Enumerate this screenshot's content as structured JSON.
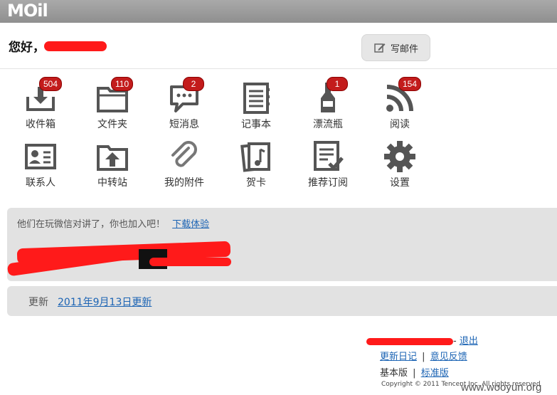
{
  "topbar": {
    "logo_text": "MOil"
  },
  "header": {
    "greeting": "您好，",
    "compose_label": "写邮件"
  },
  "apps": [
    {
      "key": "inbox",
      "label": "收件箱",
      "badge": "504",
      "icon": "inbox-icon"
    },
    {
      "key": "folders",
      "label": "文件夹",
      "badge": "110",
      "icon": "folder-icon"
    },
    {
      "key": "sms",
      "label": "短消息",
      "badge": "2",
      "icon": "message-icon"
    },
    {
      "key": "notes",
      "label": "记事本",
      "badge": "",
      "icon": "notebook-icon"
    },
    {
      "key": "bottle",
      "label": "漂流瓶",
      "badge": "1",
      "icon": "bottle-icon"
    },
    {
      "key": "reader",
      "label": "阅读",
      "badge": "154",
      "icon": "rss-icon"
    },
    {
      "key": "contacts",
      "label": "联系人",
      "badge": "",
      "icon": "contact-card-icon"
    },
    {
      "key": "transfer",
      "label": "中转站",
      "badge": "",
      "icon": "upload-folder-icon"
    },
    {
      "key": "attachments",
      "label": "我的附件",
      "badge": "",
      "icon": "paperclip-icon"
    },
    {
      "key": "cards",
      "label": "贺卡",
      "badge": "",
      "icon": "greeting-card-icon"
    },
    {
      "key": "subscriptions",
      "label": "推荐订阅",
      "badge": "",
      "icon": "subscription-icon"
    },
    {
      "key": "settings",
      "label": "设置",
      "badge": "",
      "icon": "gear-icon"
    }
  ],
  "promo": {
    "text": "他们在玩微信对讲了，你也加入吧！",
    "link": "下载体验"
  },
  "update": {
    "label": "更新",
    "link": "2011年9月13日更新"
  },
  "footer": {
    "logout": "退出",
    "changelog": "更新日记",
    "feedback": "意见反馈",
    "basic": "基本版",
    "standard": "标准版",
    "separator": "|",
    "copyright": "Copyright © 2011 Tencent Inc. All rights reserved",
    "watermark": "www.wooyun.org"
  },
  "colors": {
    "badge": "#c31c1c",
    "link": "#1c64b4",
    "topbar": "#9a9a9a",
    "panel": "#e2e2e2",
    "redaction": "#ff1a1a"
  }
}
